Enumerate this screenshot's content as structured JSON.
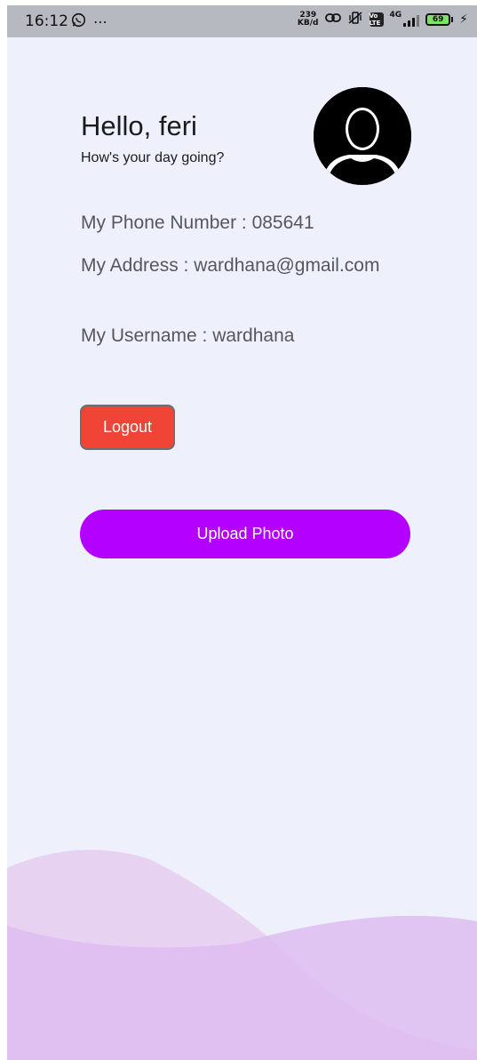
{
  "status_bar": {
    "time": "16:12",
    "speed_value": "239",
    "speed_unit": "KB/d",
    "volte_label": "Vo LTE",
    "network_label": "4G",
    "battery_level": "69"
  },
  "profile": {
    "greeting": "Hello, feri",
    "subtitle": "How's your day going?",
    "phone_line": "My Phone Number : 085641",
    "address_line": "My Address : wardhana@gmail.com",
    "username_line": "My Username : wardhana"
  },
  "actions": {
    "logout_label": "Logout",
    "upload_label": "Upload Photo"
  },
  "colors": {
    "background": "#EEF0FB",
    "logout": "#F04437",
    "upload": "#B400FF",
    "wave_light": "#E6CFF0",
    "wave_dark": "#DDB8EE"
  }
}
